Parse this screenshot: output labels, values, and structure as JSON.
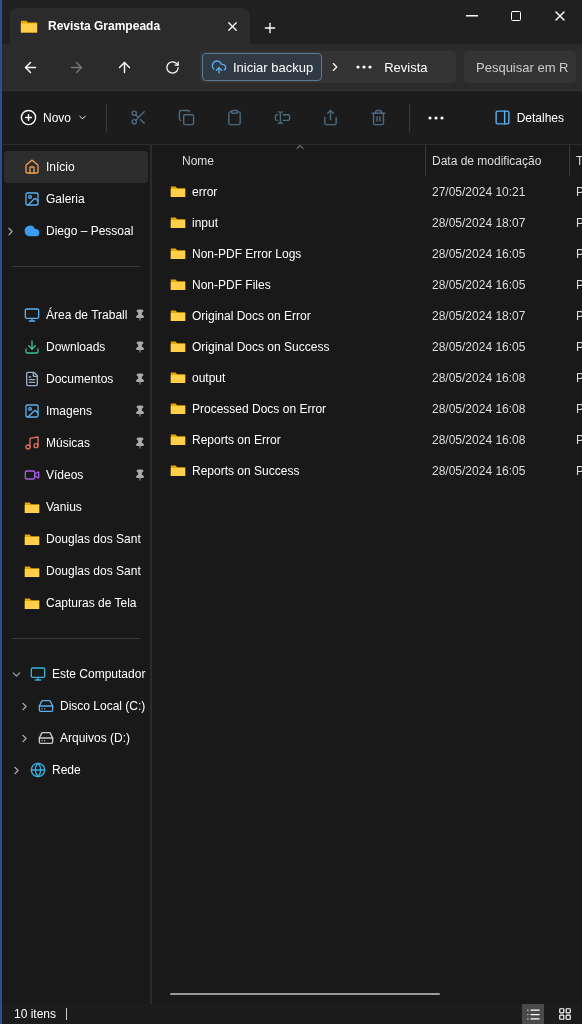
{
  "window": {
    "tab_title": "Revista Grampeada"
  },
  "address_bar": {
    "backup_button": "Iniciar backup",
    "path": [
      "Revista"
    ],
    "search_placeholder": "Pesquisar em R"
  },
  "toolbar": {
    "new_button": "Novo",
    "actions": [
      {
        "kind": "cut",
        "disabled": true
      },
      {
        "kind": "copy",
        "disabled": true
      },
      {
        "kind": "paste",
        "disabled": true
      },
      {
        "kind": "rename",
        "disabled": true
      },
      {
        "kind": "share",
        "disabled": true
      },
      {
        "kind": "delete",
        "disabled": true
      }
    ],
    "details_button": "Detalhes"
  },
  "sidebar": {
    "top": [
      {
        "label": "Início",
        "kind": "home",
        "selected": true
      },
      {
        "label": "Galeria",
        "kind": "gallery",
        "selected": false
      },
      {
        "label": "Diego – Pessoal",
        "kind": "cloud",
        "selected": false,
        "expanded": false
      }
    ],
    "pinned": [
      {
        "label": "Área de Traball",
        "kind": "desktop",
        "selected": false,
        "pinned": true
      },
      {
        "label": "Downloads",
        "kind": "download",
        "selected": false,
        "pinned": true
      },
      {
        "label": "Documentos",
        "kind": "document",
        "selected": false,
        "pinned": true
      },
      {
        "label": "Imagens",
        "kind": "image",
        "selected": false,
        "pinned": true
      },
      {
        "label": "Músicas",
        "kind": "music",
        "selected": false,
        "pinned": true
      },
      {
        "label": "Vídeos",
        "kind": "video",
        "selected": false,
        "pinned": true
      },
      {
        "label": "Vanius",
        "kind": "folder",
        "selected": false,
        "pinned": false
      },
      {
        "label": "Douglas dos Sant",
        "kind": "folder",
        "selected": false,
        "pinned": false
      },
      {
        "label": "Douglas dos Sant",
        "kind": "folder",
        "selected": false,
        "pinned": false
      },
      {
        "label": "Capturas de Tela",
        "kind": "folder",
        "selected": false,
        "pinned": false
      }
    ],
    "devices": [
      {
        "label": "Este Computador",
        "kind": "computer",
        "selected": false,
        "expanded": true,
        "children": [
          {
            "label": "Disco Local (C:)",
            "kind": "system-drive",
            "selected": false,
            "expanded": false
          },
          {
            "label": "Arquivos (D:)",
            "kind": "drive",
            "selected": false,
            "expanded": false
          }
        ]
      },
      {
        "label": "Rede",
        "kind": "network",
        "selected": false,
        "expanded": false
      }
    ]
  },
  "table": {
    "columns": [
      "Nome",
      "Data de modificação",
      "T"
    ],
    "rows": [
      {
        "name": "error",
        "modified": "27/05/2024 10:21",
        "column_3": "P"
      },
      {
        "name": "input",
        "modified": "28/05/2024 18:07",
        "column_3": "P"
      },
      {
        "name": "Non-PDF Error Logs",
        "modified": "28/05/2024 16:05",
        "column_3": "P"
      },
      {
        "name": "Non-PDF Files",
        "modified": "28/05/2024 16:05",
        "column_3": "P"
      },
      {
        "name": "Original Docs on Error",
        "modified": "28/05/2024 18:07",
        "column_3": "P"
      },
      {
        "name": "Original Docs on Success",
        "modified": "28/05/2024 16:05",
        "column_3": "P"
      },
      {
        "name": "output",
        "modified": "28/05/2024 16:08",
        "column_3": "P"
      },
      {
        "name": "Processed Docs on Error",
        "modified": "28/05/2024 16:08",
        "column_3": "P"
      },
      {
        "name": "Reports on Error",
        "modified": "28/05/2024 16:08",
        "column_3": "P"
      },
      {
        "name": "Reports on Success",
        "modified": "28/05/2024 16:05",
        "column_3": "P"
      }
    ]
  },
  "status_bar": {
    "count": "10 itens",
    "views": [
      {
        "kind": "details",
        "selected": true
      },
      {
        "kind": "tiles",
        "selected": false
      }
    ]
  }
}
